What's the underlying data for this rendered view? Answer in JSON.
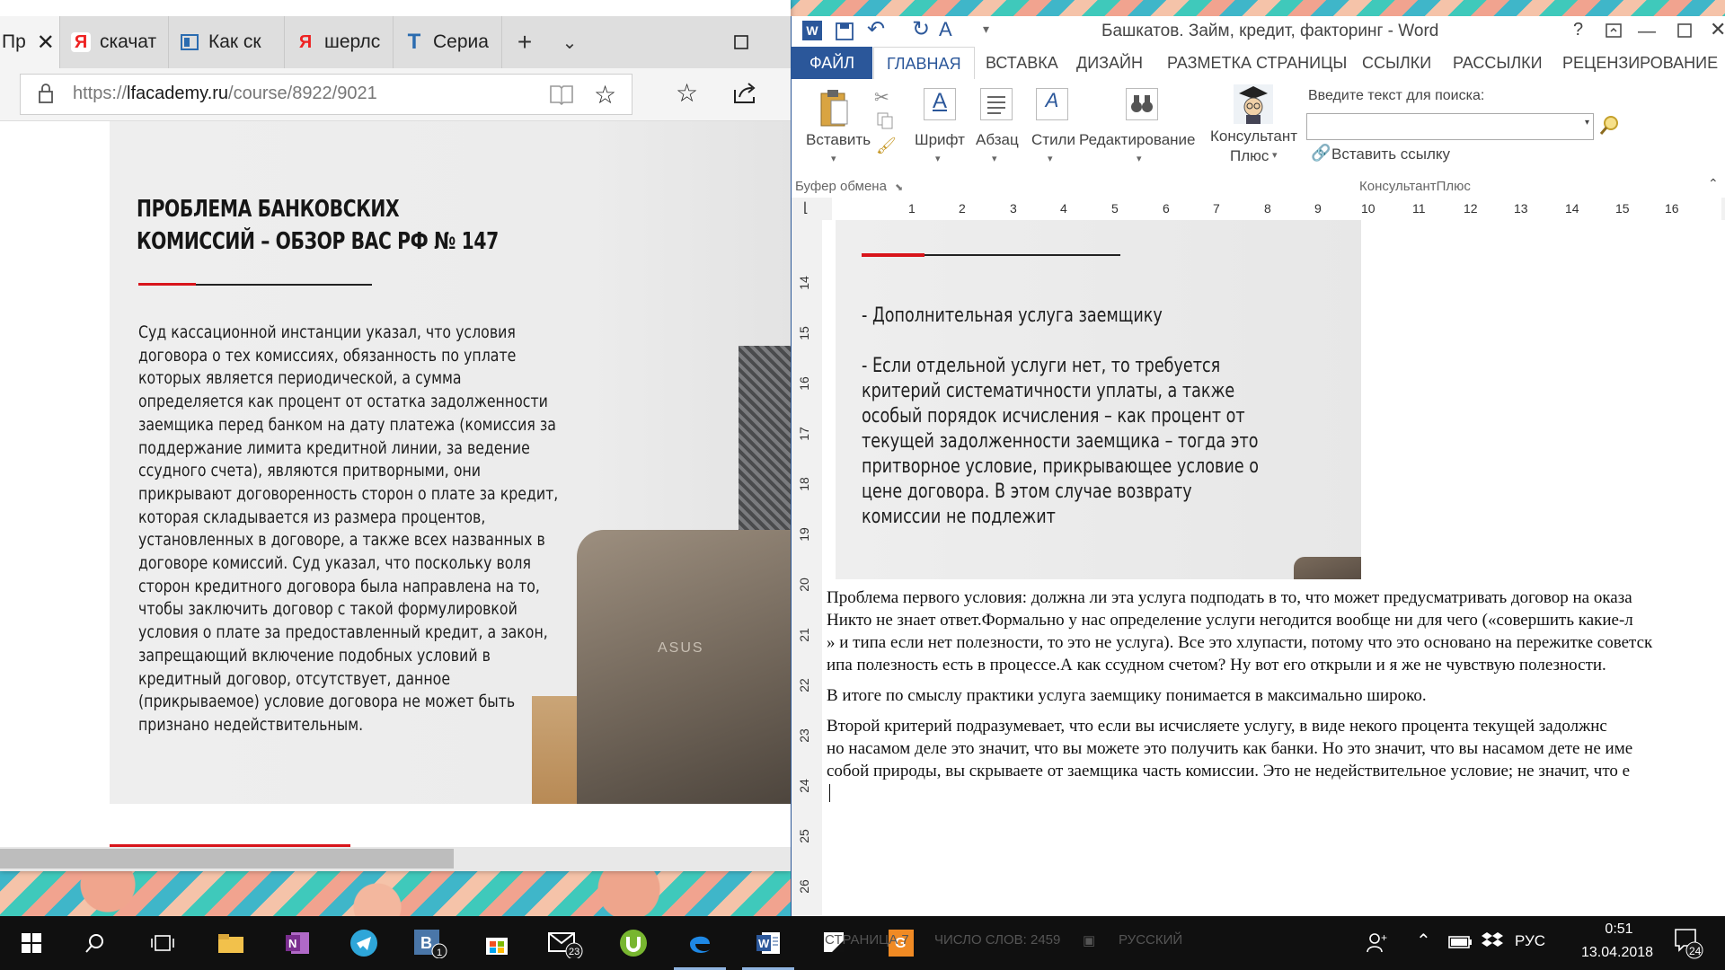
{
  "browser": {
    "tabs": [
      {
        "label": "Пр"
      },
      {
        "label": "скачат"
      },
      {
        "label": "Как ск"
      },
      {
        "label": "шерлс"
      },
      {
        "label": "Сериа"
      }
    ],
    "url": {
      "scheme": "https://",
      "domain": "lfacademy.ru",
      "path": "/course/8922/9021"
    }
  },
  "slide": {
    "title": "ПРОБЛЕМА БАНКОВСКИХ КОМИССИЙ – ОБЗОР ВАС РФ № 147",
    "body": "Суд кассационной инстанции указал, что условия договора о тех комиссиях, обязанность по уплате которых является периодической, а сумма определяется как процент от остатка задолженности заемщика перед банком на дату платежа (комиссия за поддержание лимита кредитной линии, за ведение ссудного счета), являются притворными, они прикрывают договоренность сторон о плате за кредит, которая складывается из размера процентов, установленных в договоре, а также всех названных в договоре комиссий. Суд указал, что поскольку воля сторон кредитного договора была направлена на то, чтобы заключить договор с такой формулировкой условия о плате за предоставленный кредит, а закон, запрещающий включение подобных условий в кредитный договор, отсутствует, данное (прикрываемое) условие договора не может быть признано недействительным.",
    "laptop_brand": "ASUS"
  },
  "word": {
    "title": "Башкатов. Займ, кредит, факторинг - Word",
    "tabs": [
      "ФАЙЛ",
      "ГЛАВНАЯ",
      "ВСТАВКА",
      "ДИЗАЙН",
      "РАЗМЕТКА СТРАНИЦЫ",
      "ССЫЛКИ",
      "РАССЫЛКИ",
      "РЕЦЕНЗИРОВАНИЕ"
    ],
    "ribbon": {
      "paste": "Вставить",
      "font": "Шрифт",
      "paragraph": "Абзац",
      "styles": "Стили",
      "editing": "Редактирование",
      "consultant_line1": "Консультант",
      "consultant_line2": "Плюс",
      "search_label": "Введите текст для поиска:",
      "insert_link": "Вставить ссылку",
      "group_clipboard": "Буфер обмена",
      "group_consultant": "КонсультантПлюс"
    },
    "ruler": [
      "1",
      "2",
      "3",
      "4",
      "5",
      "6",
      "7",
      "8",
      "9",
      "10",
      "11",
      "12",
      "13",
      "14",
      "15",
      "16"
    ],
    "vruler": [
      "14",
      "15",
      "16",
      "17",
      "18",
      "19",
      "20",
      "21",
      "22",
      "23",
      "24",
      "25",
      "26"
    ],
    "image_text": [
      "- Дополнительная услуга заемщику",
      "- Если отдельной услуги нет, то требуется критерий систематичности уплаты, а также особый порядок исчисления – как процент от текущей задолженности заемщика – тогда это притворное условие, прикрывающее условие о цене договора. В этом случае возврату комиссии не подлежит"
    ],
    "paragraphs": [
      "   Проблема первого условия: должна ли эта услуга подподать в то, что может предусматривать договор на оказа",
      "Никто не знает ответ.Формально у нас определение услуги негодится вообще ни для чего («совершить какие-л",
      "»  и типа если нет полезности, то это не услуга). Все это хлупасти, потому что это основано на пережитке советск",
      "ипа полезность есть в процессе.А как ссудном счетом? Ну вот его открыли и я же не чувствую полезности.",
      "   В итоге по смыслу практики услуга заемщику понимается в максимально широко.",
      "   Второй критерий подразумевает, что если вы исчисляете услугу, в виде некого процента текущей задолжнс",
      " но насамом деле это значит, что вы можете это получить как банки. Но это значит, что вы насамом дете не име",
      "собой природы, вы скрываете от заемщика часть комиссии. Это не недействительное условие; не значит, что е"
    ],
    "status": {
      "page": "СТРАНИЦА 7",
      "words": "ЧИСЛО СЛОВ: 2459",
      "language": "РУССКИЙ"
    }
  },
  "taskbar": {
    "badge_vk": "1",
    "badge_mail": "23",
    "badge_notifications": "24",
    "lang": "РУС",
    "time": "0:51",
    "date": "13.04.2018"
  }
}
